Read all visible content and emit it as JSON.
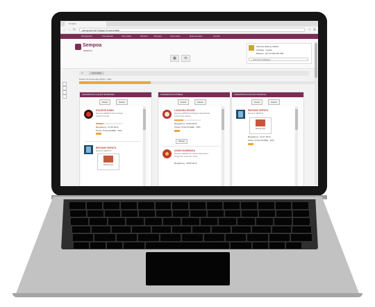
{
  "browser": {
    "tab_title": "sempoa",
    "url": "sempoa.biz/?page=Komunitas",
    "back_icon": "arrow-left-icon",
    "forward_icon": "arrow-right-icon",
    "reload_icon": "reload-icon"
  },
  "site": {
    "logo_text": "Sempoa",
    "logo_sub": "SEMPOA",
    "nav": [
      "Kantipostan",
      "Perusahaan",
      "Komunitas",
      "Member",
      "Bursaku",
      "Komunitas",
      "Rekomendasi",
      "Kontak"
    ]
  },
  "user": {
    "greeting": "Selamat Datang, Alfiahu",
    "status": "Sebagai : regular",
    "balance": "Balance : Rp 10.000.000 IDR",
    "select_placeholder": "-- DAFTAR CABANG --"
  },
  "header_icons": [
    "grid-icon",
    "mail-icon"
  ],
  "breadcrumb": {
    "home_icon": "home-icon",
    "current": "Komunitas"
  },
  "progress": {
    "label": "Power Of Community (POC) : 30%",
    "value": 0.3
  },
  "columns": [
    {
      "title": "KOMUNITAS OLAHOP BANDUNG",
      "btn_primary": "Posisi",
      "btn_secondary": "Keluar",
      "items": [
        {
          "title": "KOLEKSI NABA",
          "line1": "Bersama SEMPOA di lain wilayah",
          "line2": "Kreatif & Inovatif",
          "meta1": "Bergabung : 07-05-2014",
          "meta2": "Power Of Me (POME) : 30%",
          "progress": 0.3
        },
        {
          "title": "BINTANG SEPATU",
          "line1": "Bersama SEMPOA",
          "line2": "",
          "meta1": "",
          "meta2": "",
          "card_text": "Bintang Jaya"
        }
      ]
    },
    {
      "title": "KOMUNITAS KOTABLE",
      "btn_primary": "Posisi",
      "btn_secondary": "Keluar",
      "items": [
        {
          "title": "LASAGNA HOUSE",
          "line1": "Bersama SEMPOA di Wilayah Jakarta Barat",
          "line2": "Kuliner khas Jakarta",
          "meta1": "Bergabung : 25-05-2014",
          "meta2": "Power Of Me (POME) : 35%",
          "progress": 0.35,
          "action": "Mutasi"
        },
        {
          "title": "DAKIN DAMBAISA",
          "line1": "Bersama SEMPOA di wilayah lokasi bisnis",
          "line2": "Pengiriman cepat dan ramah",
          "meta1": "Bergabung : 28-05-2014",
          "meta2": ""
        }
      ]
    },
    {
      "title": "KOMUNITAS KOTA DIL INOFFOO",
      "btn_primary": "Posisi",
      "btn_secondary": "Keluar",
      "items": [
        {
          "title": "BINTANG SEPATU",
          "line1": "Bersama SEMPOA",
          "line2": "",
          "meta1": "Bergabung : 21-07-2014",
          "meta2": "Power Of Me (POME) : 40%",
          "progress": 0.4,
          "card_text": "Bintang Jaya"
        }
      ]
    }
  ],
  "colors": {
    "brand": "#7b2d56",
    "accent": "#f0a43a",
    "title_red": "#c04a3a"
  }
}
